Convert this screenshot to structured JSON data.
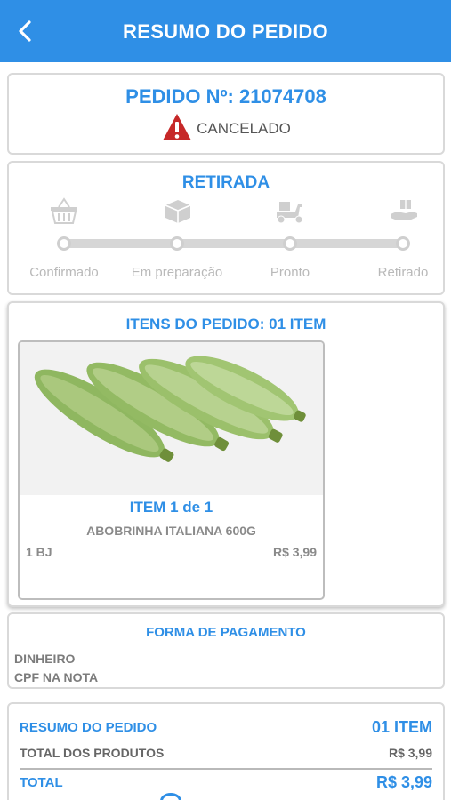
{
  "header": {
    "title": "RESUMO DO PEDIDO",
    "back_icon": "chevron-left-icon"
  },
  "order": {
    "number_label": "PEDIDO Nº: 21074708",
    "status": "CANCELADO",
    "status_icon": "warning-icon",
    "status_color": "#c62828"
  },
  "pickup": {
    "title": "RETIRADA",
    "steps": [
      {
        "label": "Confirmado",
        "icon": "basket-icon"
      },
      {
        "label": "Em preparação",
        "icon": "box-icon"
      },
      {
        "label": "Pronto",
        "icon": "delivery-scooter-icon"
      },
      {
        "label": "Retirado",
        "icon": "hand-package-icon"
      }
    ]
  },
  "items": {
    "title": "ITENS DO PEDIDO: 01 ITEM",
    "list": [
      {
        "count_label": "ITEM 1 de 1",
        "name": "ABOBRINHA ITALIANA 600G",
        "qty": "1 BJ",
        "price": "R$ 3,99",
        "image": "zucchini-image"
      }
    ]
  },
  "payment": {
    "title": "FORMA DE PAGAMENTO",
    "method": "DINHEIRO",
    "cpf": "CPF NA NOTA"
  },
  "summary": {
    "title": "RESUMO DO PEDIDO",
    "count": "01 ITEM",
    "products_label": "TOTAL DOS PRODUTOS",
    "products_value": "R$ 3,99",
    "total_label": "TOTAL",
    "total_value": "R$ 3,99"
  },
  "colors": {
    "accent": "#2f8fe6",
    "muted": "#b9b9b9",
    "border": "#d9d9d9"
  }
}
